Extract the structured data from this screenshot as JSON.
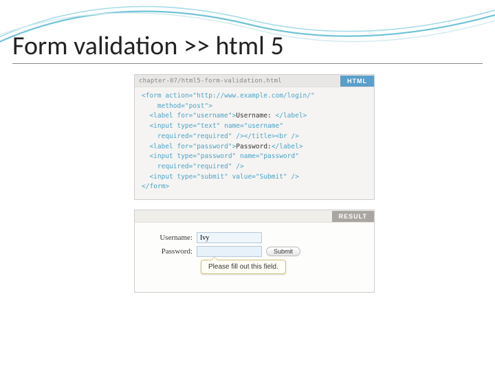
{
  "slide": {
    "title": "Form validation >> html 5"
  },
  "codePane": {
    "file": "chapter-07/html5-form-validation.html",
    "badge": "HTML",
    "line1a": "<form action=",
    "line1b": "\"http://www.example.com/login/\"",
    "line2a": "    method=",
    "line2b": "\"post\"",
    "line2c": ">",
    "line3a": "  <label for=",
    "line3b": "\"username\"",
    "line3c": ">",
    "line3d": "Username: ",
    "line3e": "</label>",
    "line4a": "  <input type=",
    "line4b": "\"text\"",
    "line4c": " name=",
    "line4d": "\"username\"",
    "line5a": "    required=",
    "line5b": "\"required\"",
    "line5c": " /></title><br />",
    "line6a": "  <label for=",
    "line6b": "\"password\"",
    "line6c": ">",
    "line6d": "Password:",
    "line6e": "</label>",
    "line7a": "  <input type=",
    "line7b": "\"password\"",
    "line7c": " name=",
    "line7d": "\"password\"",
    "line8a": "    required=",
    "line8b": "\"required\"",
    "line8c": " />",
    "line9a": "  <input type=",
    "line9b": "\"submit\"",
    "line9c": " value=",
    "line9d": "\"Submit\"",
    "line9e": " />",
    "line10": "</form>"
  },
  "resultPane": {
    "badge": "RESULT",
    "labelUser": "Username:",
    "labelPass": "Password:",
    "valueUser": "Ivy",
    "valuePass": "",
    "submit": "Submit",
    "tooltip": "Please fill out this field."
  }
}
